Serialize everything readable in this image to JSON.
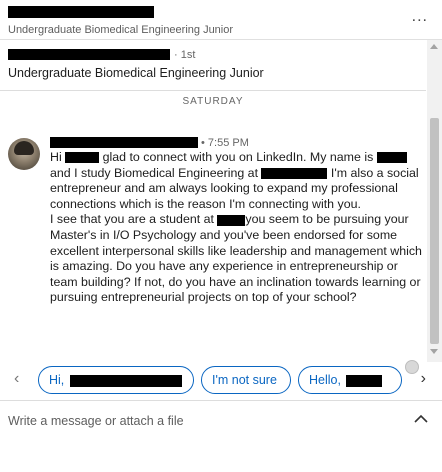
{
  "header": {
    "subtitle": "Undergraduate Biomedical Engineering Junior",
    "more_icon": "..."
  },
  "profile": {
    "degree": "· 1st",
    "headline": "Undergraduate Biomedical Engineering Junior"
  },
  "day_separator": "SATURDAY",
  "message": {
    "time": "• 7:55 PM",
    "paragraphs": [
      "Hi ▇▇▇ glad to connect with you on LinkedIn. My name is ▇▇▇ and I study Biomedical Engineering at ▇▇▇▇▇▇▇ I'm also a social entrepreneur and am always looking to expand my professional connections which is the reason I'm connecting with you.",
      "I see that you are a student at ▇▇▇ you seem to be pursuing your Master's in I/O Psychology and you've been endorsed for some excellent interpersonal skills like leadership and management which is amazing. Do you have any experience in entrepreneurship or team building? If not, do you have an inclination towards learning or pursuing entrepreneurial projects on top of your school?"
    ]
  },
  "suggestions": {
    "prev_icon": "‹",
    "next_icon": "›",
    "chips": [
      "Hi,",
      "I'm not sure",
      "Hello,"
    ]
  },
  "compose": {
    "placeholder": "Write a message or attach a file"
  }
}
